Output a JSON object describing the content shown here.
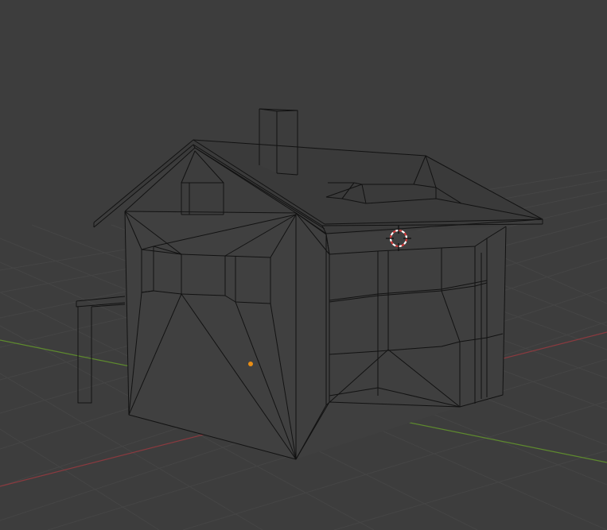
{
  "viewport": {
    "background_color": "#3d3d3d",
    "grid_color": "#454545",
    "x_axis_color": "#8a3a3f",
    "y_axis_color": "#5e8a2e",
    "wire_color": "#121212",
    "origin_color": "#e98e15",
    "cursor_colors": [
      "#d43b3b",
      "#ffffff",
      "#111111"
    ]
  },
  "scene": {
    "object": "house-mesh",
    "display_mode": "solid-wireframe",
    "icons": [
      "origin-dot-icon",
      "3d-cursor-icon"
    ]
  }
}
